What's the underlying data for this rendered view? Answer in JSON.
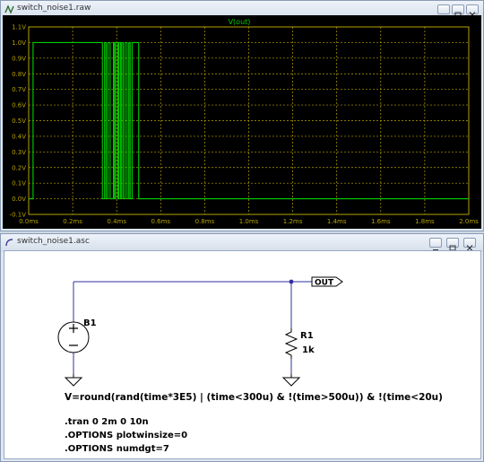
{
  "plot_window": {
    "title": "switch_noise1.raw",
    "trace_label": "V(out)",
    "trace_color": "#00d000",
    "axis_color": "#b5a200"
  },
  "schematic_window": {
    "title": "switch_noise1.asc",
    "source_name": "B1",
    "resistor_name": "R1",
    "resistor_value": "1k",
    "net_label": "OUT",
    "wire_color": "#3030a0",
    "behavior_expression": "V=round(rand(time*3E5) | (time<300u) & !(time>500u)) & !(time<20u)",
    "directives": [
      ".tran 0 2m 0 10n",
      ".OPTIONS plotwinsize=0",
      ".OPTIONS numdgt=7"
    ]
  },
  "chart_data": {
    "type": "line",
    "series": [
      {
        "name": "V(out)",
        "points": [
          [
            0,
            0
          ],
          [
            2e-05,
            0
          ],
          [
            2e-05,
            1
          ],
          [
            0.000335,
            1
          ],
          [
            0.000335,
            0
          ],
          [
            0.000345,
            0
          ],
          [
            0.000345,
            1
          ],
          [
            0.000352,
            1
          ],
          [
            0.000352,
            0
          ],
          [
            0.00036,
            0
          ],
          [
            0.00036,
            1
          ],
          [
            0.00037,
            1
          ],
          [
            0.00037,
            0
          ],
          [
            0.000385,
            0
          ],
          [
            0.000385,
            1
          ],
          [
            0.00039,
            1
          ],
          [
            0.00039,
            0
          ],
          [
            0.000395,
            0
          ],
          [
            0.000395,
            1
          ],
          [
            0.000405,
            1
          ],
          [
            0.000405,
            0
          ],
          [
            0.00041,
            0
          ],
          [
            0.00041,
            1
          ],
          [
            0.000418,
            1
          ],
          [
            0.000418,
            0
          ],
          [
            0.000423,
            0
          ],
          [
            0.000423,
            1
          ],
          [
            0.00043,
            1
          ],
          [
            0.00043,
            0
          ],
          [
            0.000438,
            0
          ],
          [
            0.000438,
            1
          ],
          [
            0.000447,
            1
          ],
          [
            0.000447,
            0
          ],
          [
            0.000455,
            0
          ],
          [
            0.000455,
            1
          ],
          [
            0.000461,
            1
          ],
          [
            0.000461,
            0
          ],
          [
            0.00047,
            0
          ],
          [
            0.00047,
            1
          ],
          [
            0.0005,
            1
          ],
          [
            0.0005,
            0
          ],
          [
            0.002,
            0
          ]
        ]
      }
    ],
    "x_ticks": [
      "0.0ms",
      "0.2ms",
      "0.4ms",
      "0.6ms",
      "0.8ms",
      "1.0ms",
      "1.2ms",
      "1.4ms",
      "1.6ms",
      "1.8ms",
      "2.0ms"
    ],
    "y_ticks": [
      "-0.1V",
      "0.0V",
      "0.1V",
      "0.2V",
      "0.3V",
      "0.4V",
      "0.5V",
      "0.6V",
      "0.7V",
      "0.8V",
      "0.9V",
      "1.0V",
      "1.1V"
    ],
    "xlim": [
      0,
      0.002
    ],
    "ylim": [
      -0.1,
      1.1
    ],
    "grid": true
  }
}
